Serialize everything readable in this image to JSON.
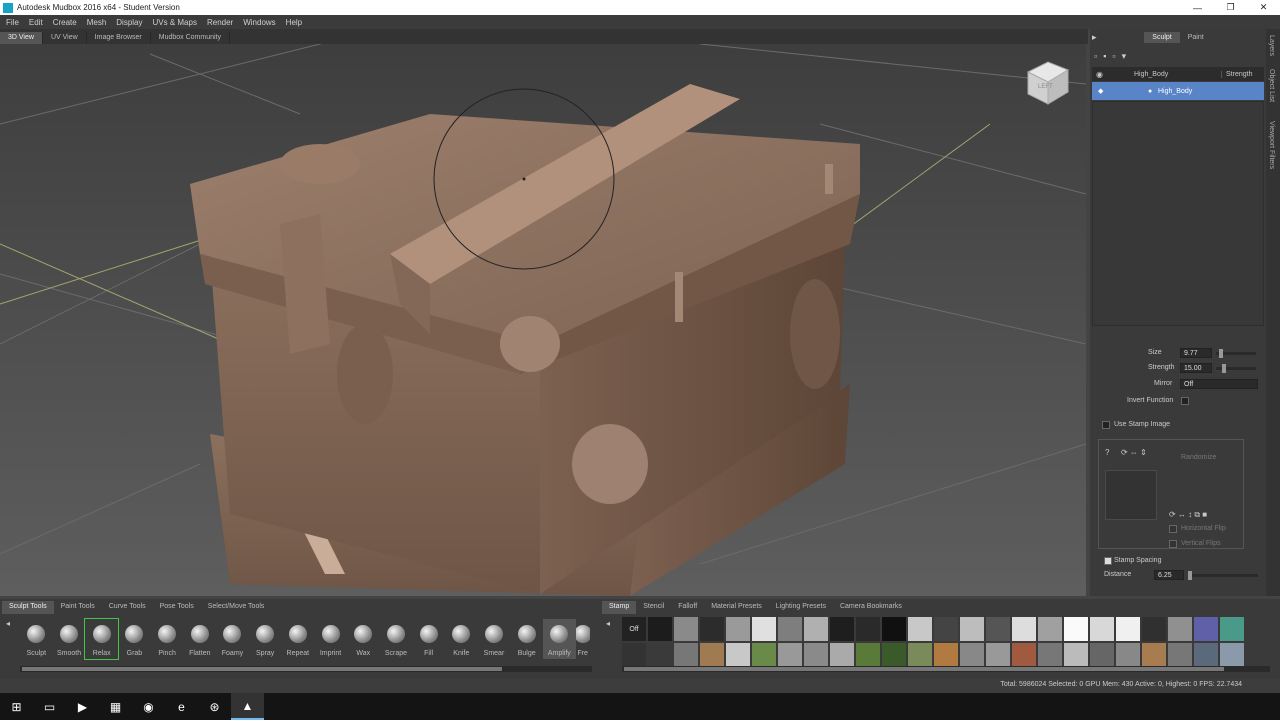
{
  "window": {
    "title": "Autodesk Mudbox 2016 x64 - Student Version",
    "minimize": "—",
    "maximize": "❐",
    "close": "✕"
  },
  "menu": [
    "File",
    "Edit",
    "Create",
    "Mesh",
    "Display",
    "UVs & Maps",
    "Render",
    "Windows",
    "Help"
  ],
  "view_tabs": [
    "3D View",
    "UV View",
    "Image Browser",
    "Mudbox Community"
  ],
  "viewport": {
    "viewcube_label": "LEFT"
  },
  "right_panel": {
    "tabs": [
      "Sculpt",
      "Paint"
    ],
    "layers": {
      "header_name": "High_Body",
      "header_strength": "Strength",
      "selected_layer": "High_Body"
    },
    "properties": {
      "size_label": "Size",
      "size_value": "9.77",
      "strength_label": "Strength",
      "strength_value": "15.00",
      "mirror_label": "Mirror",
      "mirror_value": "Off",
      "invert_label": "Invert Function",
      "use_stamp_label": "Use Stamp Image",
      "randomize_label": "Randomize",
      "hflip_label": "Horizontal Flip",
      "vflip_label": "Vertical Flips",
      "stamp_spacing_label": "Stamp Spacing",
      "distance_label": "Distance",
      "distance_value": "6.25"
    },
    "side_tabs": [
      "Layers",
      "Object List",
      "Viewport Filters"
    ]
  },
  "tool_tabs": [
    "Sculpt Tools",
    "Paint Tools",
    "Curve Tools",
    "Pose Tools",
    "Select/Move Tools"
  ],
  "tools": [
    "Sculpt",
    "Smooth",
    "Relax",
    "Grab",
    "Pinch",
    "Flatten",
    "Foamy",
    "Spray",
    "Repeat",
    "Imprint",
    "Wax",
    "Scrape",
    "Fill",
    "Knife",
    "Smear",
    "Bulge",
    "Amplify",
    "Fre"
  ],
  "selected_tool": "Relax",
  "stamp_tabs": [
    "Stamp",
    "Stencil",
    "Falloff",
    "Material Presets",
    "Lighting Presets",
    "Camera Bookmarks"
  ],
  "stamp_off_label": "Off",
  "status": "Total: 5986024  Selected: 0  GPU Mem: 430  Active: 0, Highest: 0  FPS: 22.7434"
}
